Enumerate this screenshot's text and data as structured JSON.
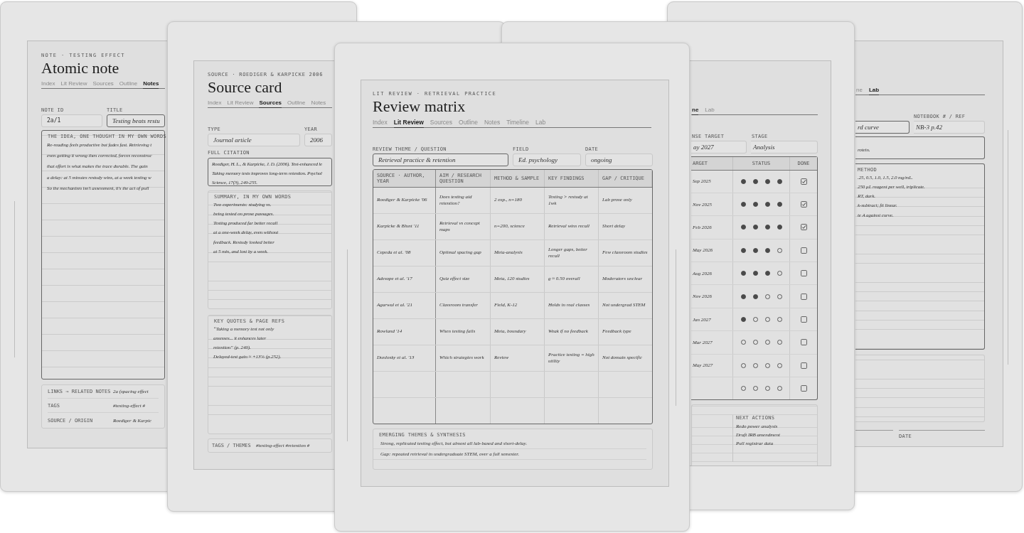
{
  "atomic_note": {
    "eyebrow": "NOTE · TESTING EFFECT",
    "title": "Atomic note",
    "tabs": [
      {
        "label": "Index",
        "selected": false
      },
      {
        "label": "Lit Review",
        "selected": false
      },
      {
        "label": "Sources",
        "selected": false
      },
      {
        "label": "Outline",
        "selected": false
      },
      {
        "label": "Notes",
        "selected": true
      }
    ],
    "fields": [
      {
        "label": "NOTE ID",
        "value": "2a/1"
      },
      {
        "label": "TITLE",
        "value": "Testing beats restu"
      }
    ],
    "idea": {
      "label": "THE IDEA, ONE THOUGHT IN MY OWN WORDS",
      "lines": [
        "Re-reading feels productive but fades fast. Retrieving t",
        "even getting it wrong then corrected, forces reconstruc",
        "that effort is what makes the trace durable. The gain",
        "a delay: at 5 minutes restudy wins, at a week testing w",
        "So the mechanism isn't assessment, it's the act of pull"
      ]
    },
    "meta": [
      {
        "label": "LINKS → RELATED NOTES",
        "value": "2a (spacing effect"
      },
      {
        "label": "TAGS",
        "value": "#testing-effect #"
      },
      {
        "label": "SOURCE / ORIGIN",
        "value": "Roediger & Karpic"
      }
    ]
  },
  "source_card": {
    "eyebrow": "SOURCE · ROEDIGER & KARPICKE 2006",
    "title": "Source card",
    "tabs": [
      {
        "label": "Index",
        "selected": false
      },
      {
        "label": "Lit Review",
        "selected": false
      },
      {
        "label": "Sources",
        "selected": true
      },
      {
        "label": "Outline",
        "selected": false
      },
      {
        "label": "Notes",
        "selected": false
      }
    ],
    "fields": [
      {
        "label": "TYPE",
        "value": "Journal article"
      },
      {
        "label": "YEAR",
        "value": "2006"
      }
    ],
    "citation": {
      "label": "FULL CITATION",
      "lines": [
        "Roediger, H. L., & Karpicke, J. D. (2006). Test-enhanced le",
        "Taking memory tests improves long-term retention. Psychol",
        "Science, 17(3), 249-255."
      ]
    },
    "summary": {
      "label": "SUMMARY, IN MY OWN WORDS",
      "lines": [
        "Two experiments: studying vs.",
        "being tested on prose passages.",
        "Testing produced far better recall",
        "at a one-week delay, even without",
        "feedback. Restudy looked better",
        "at 5 min, and lost by a week."
      ]
    },
    "quotes": {
      "label": "KEY QUOTES & PAGE REFS",
      "lines": [
        "“Taking a memory test not only",
        "assesses... it enhances later",
        "retention” (p. 249).",
        "Delayed-test gain ≈ +13% (p.252)."
      ]
    },
    "tags": {
      "label": "TAGS / THEMES",
      "value": "#testing-effect #retention #"
    }
  },
  "review_matrix": {
    "eyebrow": "LIT REVIEW · RETRIEVAL PRACTICE",
    "title": "Review matrix",
    "tabs": [
      {
        "label": "Index",
        "selected": false
      },
      {
        "label": "Lit Review",
        "selected": true
      },
      {
        "label": "Sources",
        "selected": false
      },
      {
        "label": "Outline",
        "selected": false
      },
      {
        "label": "Notes",
        "selected": false
      },
      {
        "label": "Timeline",
        "selected": false
      },
      {
        "label": "Lab",
        "selected": false
      }
    ],
    "fields": [
      {
        "label": "REVIEW THEME / QUESTION",
        "value": "Retrieval practice & retention"
      },
      {
        "label": "FIELD",
        "value": "Ed. psychology"
      },
      {
        "label": "DATE",
        "value": "ongoing"
      }
    ],
    "columns": [
      "SOURCE · AUTHOR, YEAR",
      "AIM / RESEARCH QUESTION",
      "METHOD & SAMPLE",
      "KEY FINDINGS",
      "GAP / CRITIQUE"
    ],
    "rows": [
      [
        "Roediger & Karpicke '06",
        "Does testing aid retention?",
        "2 exp., n=180",
        "Testing > restudy at 1wk",
        "Lab prose only"
      ],
      [
        "Karpicke & Blunt '11",
        "Retrieval vs concept maps",
        "n=200, science",
        "Retrieval wins recall",
        "Short delay"
      ],
      [
        "Cepeda et al. '08",
        "Optimal spacing gap",
        "Meta-analysis",
        "Longer gaps, better recall",
        "Few classroom studies"
      ],
      [
        "Adesope et al. '17",
        "Quiz effect size",
        "Meta, 120 studies",
        "g ≈ 0.50 overall",
        "Moderators unclear"
      ],
      [
        "Agarwal et al. '21",
        "Classroom transfer",
        "Field, K-12",
        "Holds in real classes",
        "Not undergrad STEM"
      ],
      [
        "Rowland '14",
        "When testing fails",
        "Meta, boundary",
        "Weak if no feedback",
        "Feedback type"
      ],
      [
        "Dunlosky et al. '13",
        "Which strategies work",
        "Review",
        "Practice testing = high utility",
        "Not domain specific"
      ]
    ],
    "synthesis": {
      "label": "EMERGING THEMES & SYNTHESIS",
      "lines": [
        "Strong, replicated testing effect, but almost all lab-based and short-delay.",
        "Gap: repeated retrieval in undergraduate STEM, over a full semester."
      ]
    }
  },
  "timeline": {
    "tabs": [
      {
        "label": "ne",
        "selected": true
      },
      {
        "label": "Lab",
        "selected": false
      }
    ],
    "fields": [
      {
        "label": "NSE TARGET",
        "value": "ay 2027"
      },
      {
        "label": "STAGE",
        "value": "Analysis"
      }
    ],
    "columns": [
      "ARGET",
      "STATUS",
      "DONE"
    ],
    "rows": [
      {
        "target": "Sep 2025",
        "stars": 4,
        "checked": true
      },
      {
        "target": "Nov 2025",
        "stars": 4,
        "checked": true
      },
      {
        "target": "Feb 2026",
        "stars": 4,
        "checked": true
      },
      {
        "target": "May 2026",
        "stars": 3,
        "checked": false
      },
      {
        "target": "Aug 2026",
        "stars": 3,
        "checked": false
      },
      {
        "target": "Nov 2026",
        "stars": 2,
        "checked": false
      },
      {
        "target": "Jan 2027",
        "stars": 1,
        "checked": false
      },
      {
        "target": "Mar 2027",
        "stars": 0,
        "checked": false
      },
      {
        "target": "May 2027",
        "stars": 0,
        "checked": false
      },
      {
        "stars": 0,
        "checked": false
      }
    ],
    "next_actions": {
      "label": "NEXT ACTIONS",
      "items": [
        "Redo power analysis",
        "Draft IRB amendment",
        "Pull registrar data"
      ]
    }
  },
  "lab": {
    "tabs": [
      {
        "label": "ne",
        "selected": false
      },
      {
        "label": "Lab",
        "selected": true
      }
    ],
    "fields": [
      {
        "value": "rd curve"
      },
      {
        "label": "NOTEBOOK # / REF",
        "value": "NB-3 p.42"
      }
    ],
    "aim_lines": [
      "rotein."
    ],
    "method": {
      "label": "METHOD",
      "lines": [
        ".25, 0.5, 1.0, 1.5, 2.0 mg/mL.",
        "250 µL reagent per well, triplicate.",
        "RT, dark.",
        "k-subtract; fit linear.",
        "te A against curve."
      ]
    },
    "date_label": "DATE"
  }
}
